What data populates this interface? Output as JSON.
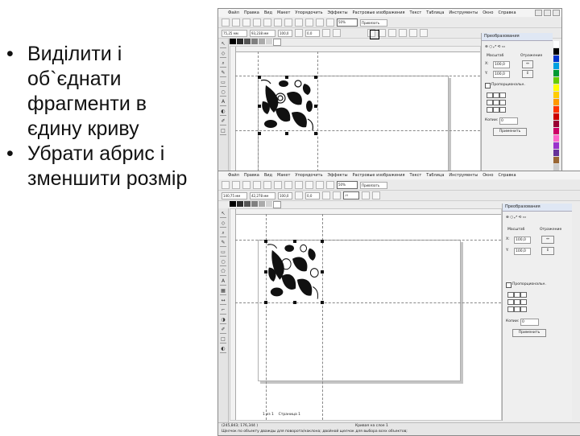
{
  "slide": {
    "bullets": [
      {
        "lines": [
          "Виділити і",
          "об`єднати",
          "фрагменти в",
          "єдину криву"
        ]
      },
      {
        "lines": [
          "Убрати абрис і",
          "зменшити розмір"
        ]
      }
    ]
  },
  "app_top": {
    "menu": [
      "Файл",
      "Правка",
      "Вид",
      "Макет",
      "Упорядочить",
      "Эффекты",
      "Растровые изображения",
      "Текст",
      "Таблица",
      "Инструменты",
      "Окно",
      "Справка"
    ],
    "props": {
      "x": "75,25 мм",
      "y": "139,75 мм",
      "w": "93,238 мм",
      "h": "95,127 мм",
      "scale_w": "100,0",
      "scale_h": "100,0",
      "angle": "0,0"
    },
    "zoom": "50%",
    "snap": "Привязать",
    "docker_title": "Преобразования",
    "tab_scale": "Масштаб",
    "tab_mirror": "Отражение",
    "label_x": "X:",
    "label_y": "Y:",
    "value_x": "100,0",
    "value_y": "100,0",
    "proportional": "Пропорциональн.",
    "copies_label": "Копии:",
    "copies_value": "0",
    "apply": "Применить"
  },
  "app_bottom": {
    "menu": [
      "Файл",
      "Правка",
      "Вид",
      "Макет",
      "Упорядочить",
      "Эффекты",
      "Растровые изображения",
      "Текст",
      "Таблица",
      "Инструменты",
      "Окно",
      "Справка"
    ],
    "props": {
      "x": "140,75 мм",
      "y": "133,85 мм",
      "w": "42,278 мм",
      "h": "42,567 мм",
      "scale_w": "100,0",
      "scale_h": "100,0",
      "angle": "0,0"
    },
    "zoom": "50%",
    "snap": "Привязать",
    "docker_title": "Преобразования",
    "tab_scale": "Масштаб",
    "tab_mirror": "Отражение",
    "label_x": "X:",
    "label_y": "Y:",
    "value_x": "100,0",
    "value_y": "100,0",
    "proportional": "Пропорциональн.",
    "copies_label": "Копии:",
    "copies_value": "0",
    "apply": "Применить",
    "page_tab": "1 из 1",
    "page_name": "Страница 1",
    "status_coords": "(245,843; 176,344 )",
    "status_object": "Кривая на слое 1",
    "status_line2": "Щелчок по объекту дважды для поворота/наклона; двойной щелчок для выбора всех объектов;"
  },
  "icons": {
    "pointer": "pointer-icon",
    "shape": "shape-tool-icon",
    "zoom": "zoom-icon",
    "pen": "freehand-icon",
    "rect": "rectangle-icon",
    "ellipse": "ellipse-icon",
    "text": "text-icon",
    "fill": "fill-icon"
  },
  "colors": {
    "palette": [
      "#000000",
      "#2b2b2b",
      "#555555",
      "#808080",
      "#aaaaaa",
      "#d4d4d4",
      "#ffffff",
      "#ff0000",
      "#ffff00",
      "#00a000",
      "#00bfff",
      "#0000ff",
      "#ff00ff",
      "#ff8000"
    ],
    "right_palette": [
      "#ffffff",
      "#000000",
      "#0033cc",
      "#00a0e0",
      "#009933",
      "#66cc00",
      "#ffff00",
      "#ffcc00",
      "#ff9900",
      "#ff3300",
      "#cc0000",
      "#990033",
      "#cc0066",
      "#ff66cc",
      "#9933cc",
      "#663399",
      "#996633",
      "#cc9966",
      "#cccccc",
      "#999999",
      "#666666",
      "#333333",
      "#000000"
    ]
  }
}
